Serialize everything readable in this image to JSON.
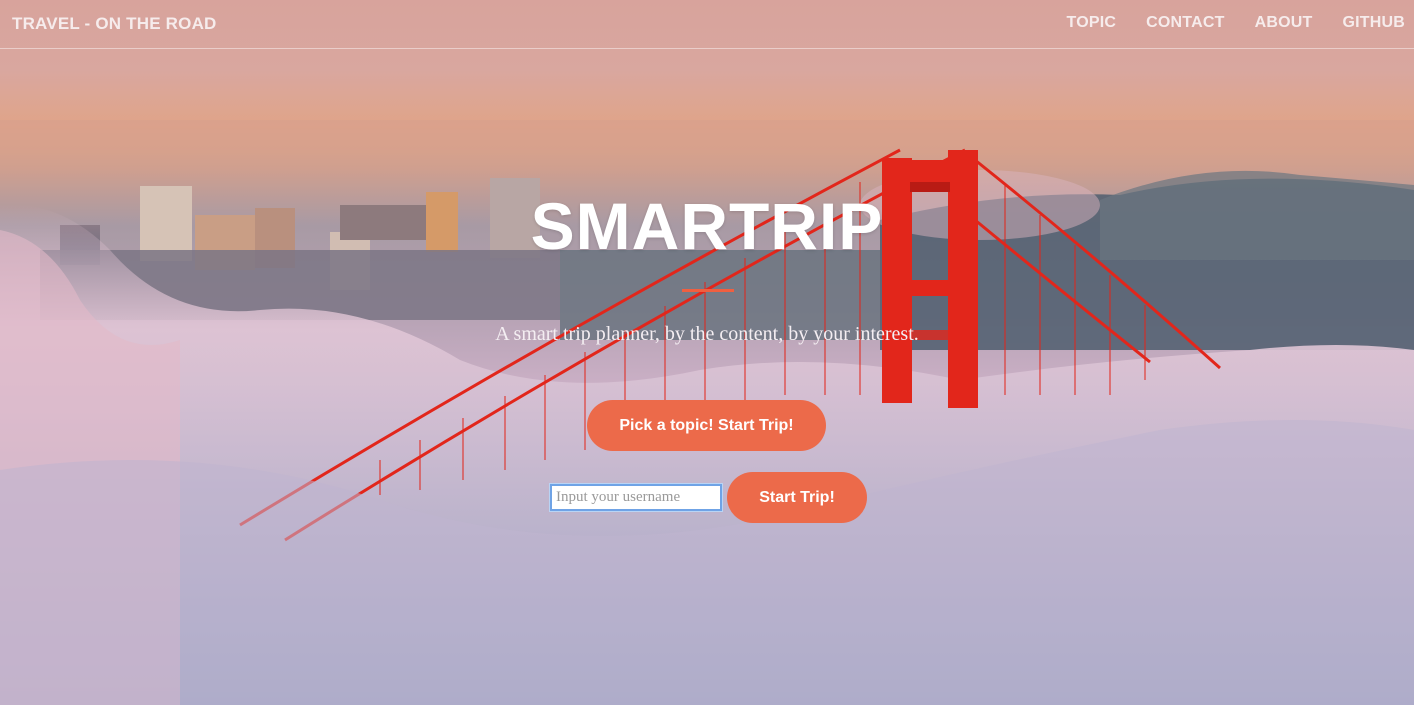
{
  "navbar": {
    "brand": "TRAVEL - ON THE ROAD",
    "links": [
      {
        "label": "TOPIC"
      },
      {
        "label": "CONTACT"
      },
      {
        "label": "ABOUT"
      },
      {
        "label": "GITHUB"
      }
    ]
  },
  "hero": {
    "title": "SMARTRIP",
    "subtitle": "A smart trip planner, by the content, by your interest.",
    "topic_button_label": "Pick a topic! Start Trip!",
    "username_placeholder": "Input your username",
    "username_value": "",
    "start_button_label": "Start Trip!"
  },
  "colors": {
    "accent": "#f05f40",
    "button": "#ec6a4a",
    "bridge": "#e2261b",
    "text_light": "#ffffff"
  }
}
